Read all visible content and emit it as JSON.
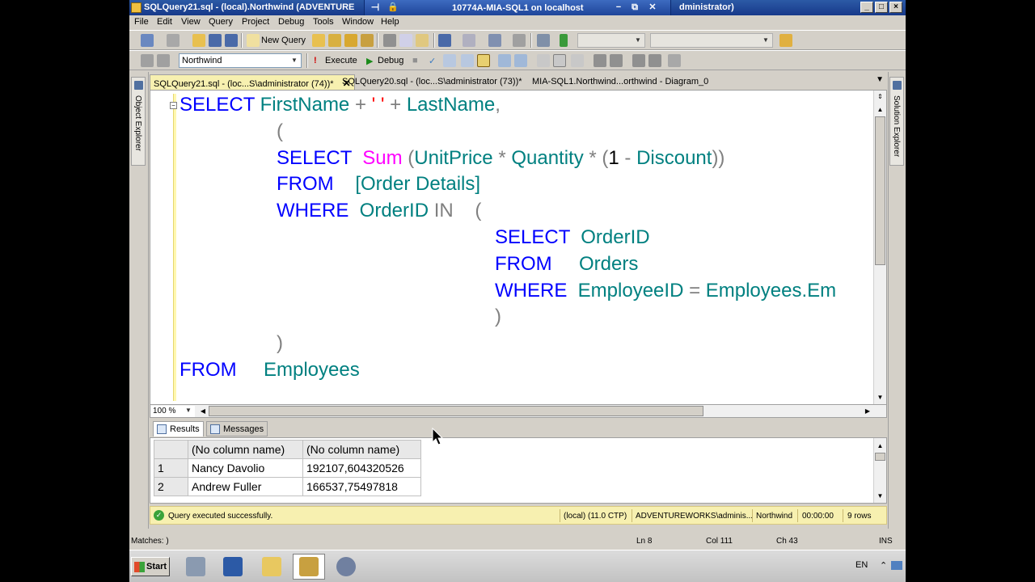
{
  "window": {
    "title": "SQLQuery21.sql - (local).Northwind (ADVENTURE",
    "title_tail": "dministrator)",
    "rdp_title": "10774A-MIA-SQL1 on localhost",
    "rdp_pin": "⊣",
    "rdp_lock": "🔒",
    "rdp_min": "−",
    "rdp_restore": "⧉",
    "rdp_close": "✕"
  },
  "menu": [
    "File",
    "Edit",
    "View",
    "Query",
    "Project",
    "Debug",
    "Tools",
    "Window",
    "Help"
  ],
  "toolbar1": {
    "new_query": "New Query"
  },
  "toolbar2": {
    "database": "Northwind",
    "execute": "Execute",
    "debug": "Debug"
  },
  "side_panels": {
    "left": "Object Explorer",
    "right": "Solution Explorer"
  },
  "doc_tabs": [
    {
      "label": "SQLQuery21.sql - (loc...S\\administrator (74))*",
      "active": true,
      "close": "✕"
    },
    {
      "label": "SQLQuery20.sql - (loc...S\\administrator (73))*",
      "active": false
    },
    {
      "label": "MIA-SQL1.Northwind...orthwind - Diagram_0",
      "active": false
    }
  ],
  "code_lines": [
    [
      [
        "kw",
        "SELECT "
      ],
      [
        "id",
        "FirstName "
      ],
      [
        "op",
        "+ "
      ],
      [
        "str",
        "' ' "
      ],
      [
        "op",
        "+ "
      ],
      [
        "id",
        "LastName"
      ],
      [
        "op",
        ","
      ]
    ],
    [
      [
        "op",
        "("
      ]
    ],
    [
      [
        "kw",
        "SELECT  "
      ],
      [
        "fn",
        "Sum "
      ],
      [
        "op",
        "("
      ],
      [
        "id",
        "UnitPrice "
      ],
      [
        "op",
        "* "
      ],
      [
        "id",
        "Quantity "
      ],
      [
        "op",
        "* ("
      ],
      [
        "num",
        "1 "
      ],
      [
        "op",
        "- "
      ],
      [
        "id",
        "Discount"
      ],
      [
        "op",
        "))"
      ]
    ],
    [
      [
        "kw",
        "FROM    "
      ],
      [
        "id",
        "[Order Details]"
      ]
    ],
    [
      [
        "kw",
        "WHERE  "
      ],
      [
        "id",
        "OrderID "
      ],
      [
        "op",
        "IN    ("
      ]
    ],
    [
      [
        "kw",
        "SELECT  "
      ],
      [
        "id",
        "OrderID"
      ]
    ],
    [
      [
        "kw",
        "FROM     "
      ],
      [
        "id",
        "Orders"
      ]
    ],
    [
      [
        "kw",
        "WHERE  "
      ],
      [
        "id",
        "EmployeeID "
      ],
      [
        "op",
        "= "
      ],
      [
        "id",
        "Employees.Em"
      ]
    ],
    [
      [
        "op",
        ")"
      ]
    ],
    [
      [
        "op",
        ")"
      ]
    ],
    [
      [
        "kw",
        "FROM     "
      ],
      [
        "id",
        "Employees"
      ]
    ]
  ],
  "zoom": "100 %",
  "results_tabs": {
    "results": "Results",
    "messages": "Messages"
  },
  "grid": {
    "columns": [
      "(No column name)",
      "(No column name)"
    ],
    "rows": [
      {
        "num": "1",
        "c1": "Nancy Davolio",
        "c2": "192107,604320526"
      },
      {
        "num": "2",
        "c1": "Andrew Fuller",
        "c2": "166537,75497818"
      }
    ]
  },
  "status": {
    "message": "Query executed successfully.",
    "server": "(local) (11.0 CTP)",
    "login": "ADVENTUREWORKS\\adminis...",
    "database": "Northwind",
    "elapsed": "00:00:00",
    "rows": "9 rows"
  },
  "bottom_status": {
    "matches": "Matches: )",
    "ln": "Ln 8",
    "col": "Col 111",
    "ch": "Ch 43",
    "ins": "INS"
  },
  "taskbar": {
    "start": "Start",
    "lang": "EN"
  },
  "colors": {
    "keyword": "#0000ff",
    "function": "#ff00ff",
    "identifier": "#008080",
    "operator": "#808080",
    "string": "#ff0000"
  }
}
